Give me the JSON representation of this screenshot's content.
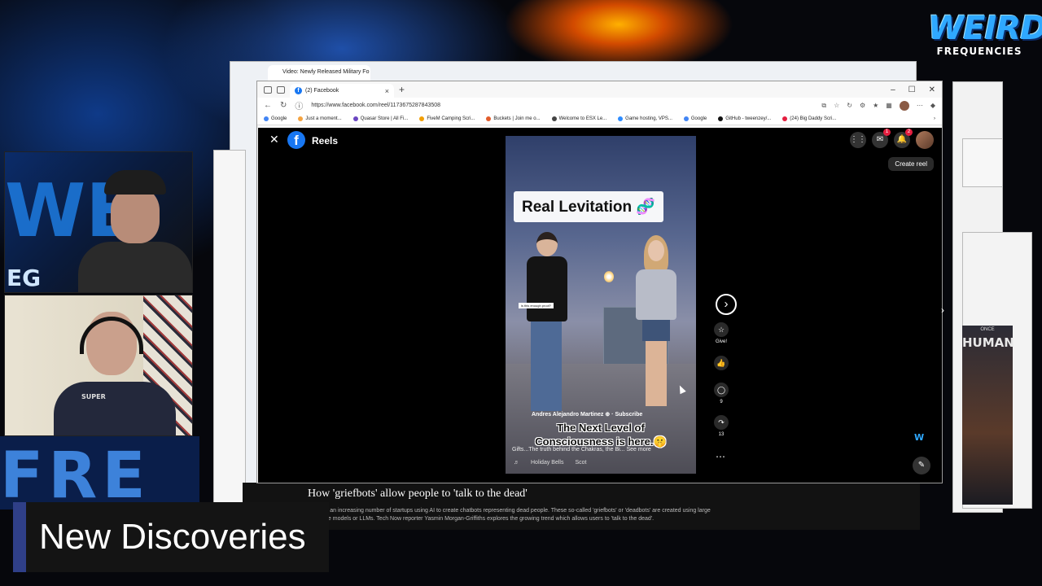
{
  "brand": {
    "logo_top": "WEIRD",
    "logo_bottom": "FREQUENCIES"
  },
  "background_window": {
    "tab_title": "Video: Newly Released Military Fo"
  },
  "browser": {
    "tab_title": "(2) Facebook",
    "new_tab": "+",
    "url": "https://www.facebook.com/reel/1173675287843508",
    "bookmarks": [
      {
        "label": "Google",
        "color": "#4285f4"
      },
      {
        "label": "Just a moment...",
        "color": "#f4a340"
      },
      {
        "label": "Quasar Store | All Fi...",
        "color": "#6b46c1"
      },
      {
        "label": "FiveM Camping Scri...",
        "color": "#f29f05"
      },
      {
        "label": "Buckets | Join me o...",
        "color": "#e25c2b"
      },
      {
        "label": "Welcome to ESX Le...",
        "color": "#444444"
      },
      {
        "label": "Game hosting, VPS...",
        "color": "#2d8cff"
      },
      {
        "label": "Google",
        "color": "#4285f4"
      },
      {
        "label": "GitHub - tweenzey/...",
        "color": "#111111"
      },
      {
        "label": "(24) Big Daddy Scri...",
        "color": "#e41e3f"
      }
    ]
  },
  "reels": {
    "title": "Reels",
    "create_label": "Create reel",
    "top_badges": {
      "messenger": "1",
      "notifications": "2"
    },
    "video": {
      "caption_title": "Real Levitation 🧬",
      "mini_caption": "is this enough proof?",
      "author": "Andres Alejandro Martinez ⊕ · Subscribe",
      "overlay_line1": "The Next Level of",
      "overlay_line2": "Consciousness is here.🤫",
      "description": "Gifts...The truth behind the Chakras, the Bi... See more",
      "music_icon": "♬",
      "music_track": "Holiday Bells",
      "music_artist": "Scot"
    },
    "actions": [
      {
        "name": "give",
        "label": "Give!",
        "icon": "☆"
      },
      {
        "name": "like",
        "label": "",
        "icon": "👍"
      },
      {
        "name": "comment",
        "label": "9",
        "icon": "◯"
      },
      {
        "name": "share",
        "label": "13",
        "icon": "↷"
      }
    ]
  },
  "article": {
    "headline": "How 'griefbots' allow people to 'talk to the dead'",
    "body": "There is an increasing number of startups using AI to create chatbots representing dead people. These so-called 'griefbots' or 'deadbots' are created using large language models or LLMs. Tech Now reporter Yasmin Morgan-Griffiths explores the growing trend which allows users to 'talk to the dead'."
  },
  "ad": {
    "small": "ONCE",
    "title": "HUMAN"
  },
  "webcam1": {
    "background_text": "WE",
    "background_sub": "EG"
  },
  "webcam2": {
    "shirt_text": "SUPER"
  },
  "stream_bg_text": "FRE",
  "lower_third": {
    "title": "New Discoveries"
  }
}
